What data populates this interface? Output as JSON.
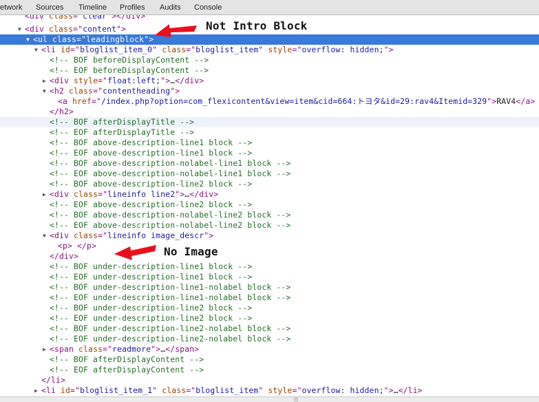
{
  "toolbar": {
    "tabs": [
      "etwork",
      "Sources",
      "Timeline",
      "Profiles",
      "Audits",
      "Console"
    ]
  },
  "tree": [
    {
      "tri": "",
      "segs": [
        [
          "t",
          "<div "
        ],
        [
          "a",
          "class"
        ],
        [
          "t",
          "=\""
        ],
        [
          "v",
          "clear"
        ],
        [
          "t",
          "\"></div>"
        ]
      ]
    },
    {
      "tri": "down",
      "segs": [
        [
          "t",
          "<div "
        ],
        [
          "a",
          "class"
        ],
        [
          "t",
          "=\""
        ],
        [
          "v",
          "content"
        ],
        [
          "t",
          "\">"
        ]
      ]
    },
    {
      "tri": "down",
      "sel": true,
      "segs": [
        [
          "t",
          "<ul "
        ],
        [
          "a",
          "class"
        ],
        [
          "t",
          "=\""
        ],
        [
          "v",
          "leadingblock"
        ],
        [
          "t",
          "\">"
        ]
      ]
    },
    {
      "tri": "down",
      "segs": [
        [
          "t",
          "<li "
        ],
        [
          "a",
          "id"
        ],
        [
          "t",
          "=\""
        ],
        [
          "v",
          "bloglist_item_0"
        ],
        [
          "t",
          "\" "
        ],
        [
          "a",
          "class"
        ],
        [
          "t",
          "=\""
        ],
        [
          "v",
          "bloglist_item"
        ],
        [
          "t",
          "\" "
        ],
        [
          "a",
          "style"
        ],
        [
          "t",
          "=\""
        ],
        [
          "v",
          "overflow: hidden;"
        ],
        [
          "t",
          "\">"
        ]
      ]
    },
    {
      "tri": "",
      "segs": [
        [
          "c",
          "<!-- BOF beforeDisplayContent -->"
        ]
      ]
    },
    {
      "tri": "",
      "segs": [
        [
          "c",
          "<!-- EOF beforeDisplayContent -->"
        ]
      ]
    },
    {
      "tri": "right",
      "segs": [
        [
          "t",
          "<div "
        ],
        [
          "a",
          "style"
        ],
        [
          "t",
          "=\""
        ],
        [
          "v",
          "float:left;"
        ],
        [
          "t",
          "\">"
        ],
        [
          "x",
          "…"
        ],
        [
          "t",
          "</div>"
        ]
      ]
    },
    {
      "tri": "down",
      "segs": [
        [
          "t",
          "<h2 "
        ],
        [
          "a",
          "class"
        ],
        [
          "t",
          "=\""
        ],
        [
          "v",
          "contentheading"
        ],
        [
          "t",
          "\">"
        ]
      ]
    },
    {
      "tri": "",
      "segs": [
        [
          "t",
          "<a "
        ],
        [
          "a",
          "href"
        ],
        [
          "t",
          "=\""
        ],
        [
          "v",
          "/index.php?option=com_flexicontent&view=item&cid=664:トヨタ&id=29:rav4&Itemid=329"
        ],
        [
          "t",
          "\">"
        ],
        [
          "x",
          "RAV4"
        ],
        [
          "t",
          "</a>"
        ]
      ]
    },
    {
      "tri": "",
      "segs": [
        [
          "t",
          "</h2>"
        ]
      ]
    },
    {
      "tri": "",
      "hover": true,
      "segs": [
        [
          "c",
          "<!-- BOF afterDisplayTitle -->"
        ]
      ]
    },
    {
      "tri": "",
      "segs": [
        [
          "c",
          "<!-- EOF afterDisplayTitle -->"
        ]
      ]
    },
    {
      "tri": "",
      "segs": [
        [
          "c",
          "<!-- BOF above-description-line1 block -->"
        ]
      ]
    },
    {
      "tri": "",
      "segs": [
        [
          "c",
          "<!-- EOF above-description-line1 block -->"
        ]
      ]
    },
    {
      "tri": "",
      "segs": [
        [
          "c",
          "<!-- BOF above-description-nolabel-line1 block -->"
        ]
      ]
    },
    {
      "tri": "",
      "segs": [
        [
          "c",
          "<!-- EOF above-description-nolabel-line1 block -->"
        ]
      ]
    },
    {
      "tri": "",
      "segs": [
        [
          "c",
          "<!-- BOF above-description-line2 block -->"
        ]
      ]
    },
    {
      "tri": "right",
      "segs": [
        [
          "t",
          "<div "
        ],
        [
          "a",
          "class"
        ],
        [
          "t",
          "=\""
        ],
        [
          "v",
          "lineinfo line2"
        ],
        [
          "t",
          "\">"
        ],
        [
          "x",
          "…"
        ],
        [
          "t",
          "</div>"
        ]
      ]
    },
    {
      "tri": "",
      "segs": [
        [
          "c",
          "<!-- EOF above-description-line2 block -->"
        ]
      ]
    },
    {
      "tri": "",
      "segs": [
        [
          "c",
          "<!-- BOF above-description-nolabel-line2 block -->"
        ]
      ]
    },
    {
      "tri": "",
      "segs": [
        [
          "c",
          "<!-- EOF above-description-nolabel-line2 block -->"
        ]
      ]
    },
    {
      "tri": "down",
      "segs": [
        [
          "t",
          "<div "
        ],
        [
          "a",
          "class"
        ],
        [
          "t",
          "=\""
        ],
        [
          "v",
          "lineinfo image_descr"
        ],
        [
          "t",
          "\">"
        ]
      ]
    },
    {
      "tri": "",
      "segs": [
        [
          "t",
          "<p>"
        ],
        [
          "x",
          " "
        ],
        [
          "t",
          "</p>"
        ]
      ]
    },
    {
      "tri": "",
      "segs": [
        [
          "t",
          "</div>"
        ]
      ]
    },
    {
      "tri": "",
      "segs": [
        [
          "c",
          "<!-- BOF under-description-line1 block -->"
        ]
      ]
    },
    {
      "tri": "",
      "segs": [
        [
          "c",
          "<!-- EOF under-description-line1 block -->"
        ]
      ]
    },
    {
      "tri": "",
      "segs": [
        [
          "c",
          "<!-- BOF under-description-line1-nolabel block -->"
        ]
      ]
    },
    {
      "tri": "",
      "segs": [
        [
          "c",
          "<!-- EOF under-description-line1-nolabel block -->"
        ]
      ]
    },
    {
      "tri": "",
      "segs": [
        [
          "c",
          "<!-- BOF under-description-line2 block -->"
        ]
      ]
    },
    {
      "tri": "",
      "segs": [
        [
          "c",
          "<!-- EOF under-description-line2 block -->"
        ]
      ]
    },
    {
      "tri": "",
      "segs": [
        [
          "c",
          "<!-- BOF under-description-line2-nolabel block -->"
        ]
      ]
    },
    {
      "tri": "",
      "segs": [
        [
          "c",
          "<!-- EOF under-description-line2-nolabel block -->"
        ]
      ]
    },
    {
      "tri": "right",
      "segs": [
        [
          "t",
          "<span "
        ],
        [
          "a",
          "class"
        ],
        [
          "t",
          "=\""
        ],
        [
          "v",
          "readmore"
        ],
        [
          "t",
          "\">"
        ],
        [
          "x",
          "…"
        ],
        [
          "t",
          "</span>"
        ]
      ]
    },
    {
      "tri": "",
      "segs": [
        [
          "c",
          "<!-- BOF afterDisplayContent -->"
        ]
      ]
    },
    {
      "tri": "",
      "segs": [
        [
          "c",
          "<!-- EOF afterDisplayContent -->"
        ]
      ]
    },
    {
      "tri": "",
      "segs": [
        [
          "t",
          "</li>"
        ]
      ]
    },
    {
      "tri": "right",
      "segs": [
        [
          "t",
          "<li "
        ],
        [
          "a",
          "id"
        ],
        [
          "t",
          "=\""
        ],
        [
          "v",
          "bloglist_item_1"
        ],
        [
          "t",
          "\" "
        ],
        [
          "a",
          "class"
        ],
        [
          "t",
          "=\""
        ],
        [
          "v",
          "bloglist_item"
        ],
        [
          "t",
          "\" "
        ],
        [
          "a",
          "style"
        ],
        [
          "t",
          "=\""
        ],
        [
          "v",
          "overflow: hidden;"
        ],
        [
          "t",
          "\">"
        ],
        [
          "x",
          "…"
        ],
        [
          "t",
          "</li>"
        ]
      ]
    }
  ],
  "annotations": {
    "not_intro": "Not Intro Block",
    "no_image": "No Image",
    "arrow_color": "#e8101a"
  },
  "colors": {
    "tag": "#881280",
    "attr": "#994500",
    "value": "#1a1aa6",
    "comment": "#236e25",
    "selection": "#3879d9"
  }
}
